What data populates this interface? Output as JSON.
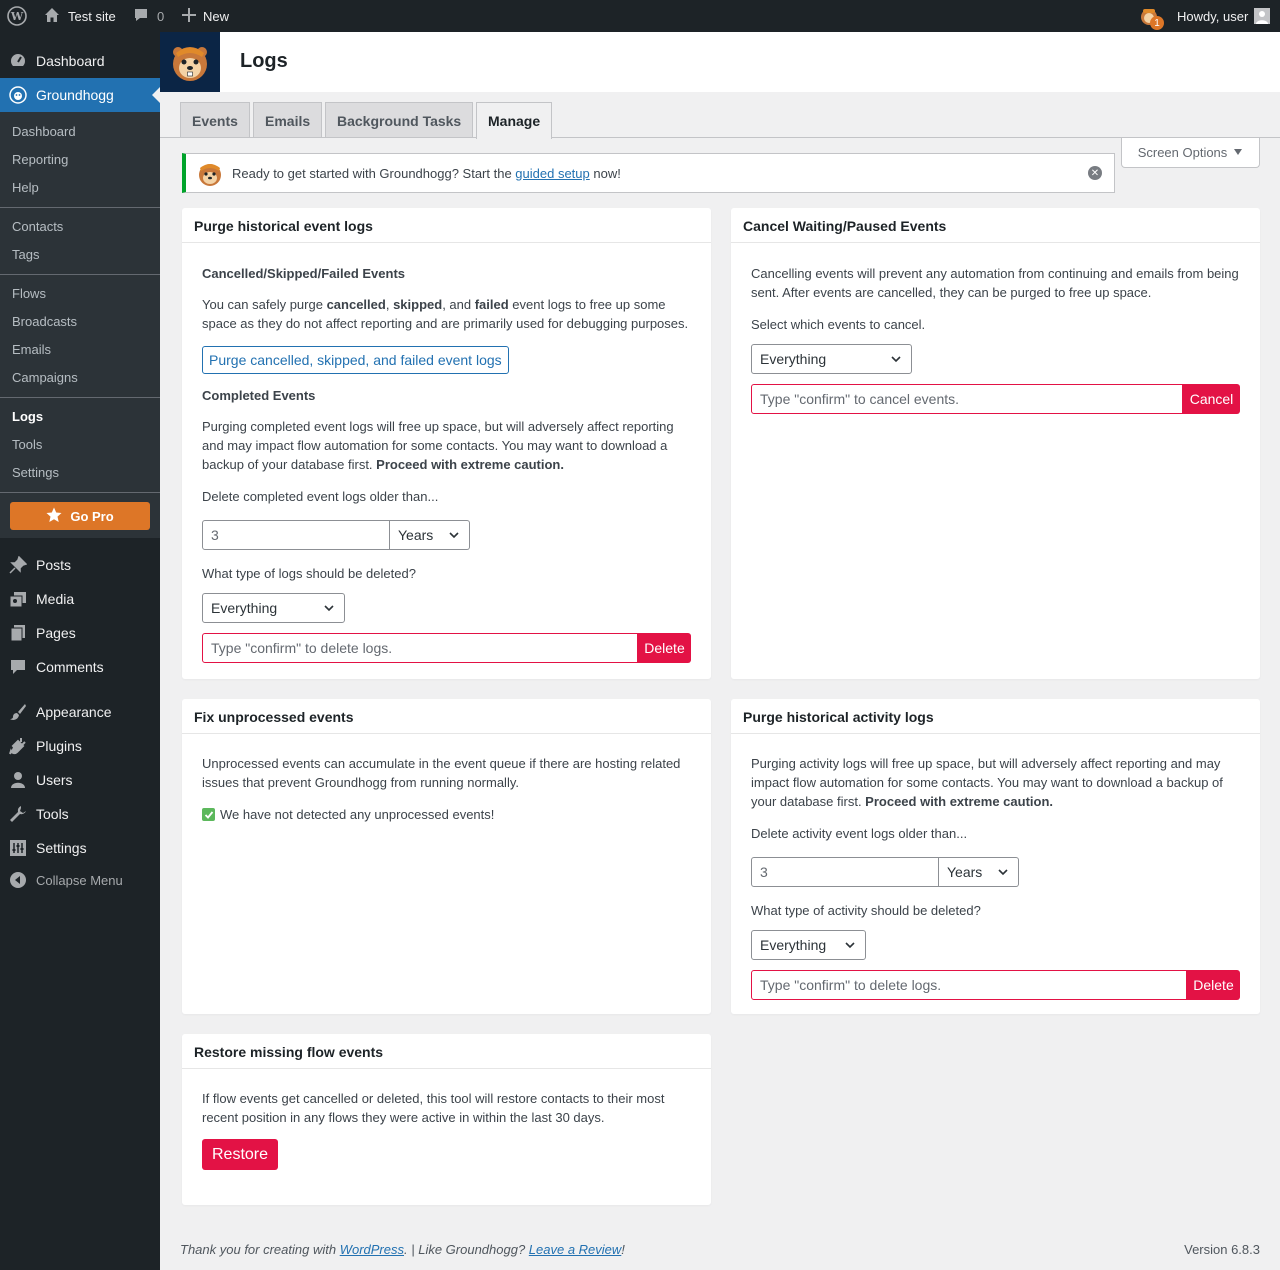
{
  "adminbar": {
    "site_name": "Test site",
    "comments_count": "0",
    "new_label": "New",
    "notification_count": "1",
    "howdy": "Howdy, user"
  },
  "sidebar": {
    "dashboard": "Dashboard",
    "groundhogg": "Groundhogg",
    "submenu": {
      "dashboard": "Dashboard",
      "reporting": "Reporting",
      "help": "Help",
      "contacts": "Contacts",
      "tags": "Tags",
      "flows": "Flows",
      "broadcasts": "Broadcasts",
      "emails": "Emails",
      "campaigns": "Campaigns",
      "logs": "Logs",
      "tools": "Tools",
      "settings": "Settings",
      "go_pro": "Go Pro"
    },
    "posts": "Posts",
    "media": "Media",
    "pages": "Pages",
    "comments": "Comments",
    "appearance": "Appearance",
    "plugins": "Plugins",
    "users": "Users",
    "tools": "Tools",
    "settings": "Settings",
    "collapse": "Collapse Menu"
  },
  "header": {
    "title": "Logs"
  },
  "tabs": {
    "events": "Events",
    "emails": "Emails",
    "background": "Background Tasks",
    "manage": "Manage"
  },
  "screen_options": "Screen Options",
  "notice": {
    "before": "Ready to get started with Groundhogg? Start the ",
    "link": "guided setup",
    "after": " now!"
  },
  "purge_event": {
    "title": "Purge historical event logs",
    "cancelled_heading": "Cancelled/Skipped/Failed Events",
    "p1_a": "You can safely purge ",
    "p1_b": "cancelled",
    "p1_c": ", ",
    "p1_d": "skipped",
    "p1_e": ", and ",
    "p1_f": "failed",
    "p1_g": " event logs to free up some space as they do not affect reporting and are primarily used for debugging purposes.",
    "purge_button": "Purge cancelled, skipped, and failed event logs",
    "completed_heading": "Completed Events",
    "p2_a": "Purging completed event logs will free up space, but will adversely affect reporting and may impact flow automation for some contacts. You may want to download a backup of your database first. ",
    "p2_b": "Proceed with extreme caution.",
    "older_label": "Delete completed event logs older than...",
    "age_value": "3",
    "age_unit": "Years",
    "type_label": "What type of logs should be deleted?",
    "type_value": "Everything",
    "confirm_placeholder": "Type \"confirm\" to delete logs.",
    "delete_button": "Delete"
  },
  "cancel_waiting": {
    "title": "Cancel Waiting/Paused Events",
    "p1": "Cancelling events will prevent any automation from continuing and emails from being sent. After events are cancelled, they can be purged to free up space.",
    "select_label": "Select which events to cancel.",
    "select_value": "Everything",
    "confirm_placeholder": "Type \"confirm\" to cancel events.",
    "cancel_button": "Cancel"
  },
  "fix_unprocessed": {
    "title": "Fix unprocessed events",
    "p1": "Unprocessed events can accumulate in the event queue if there are hosting related issues that prevent Groundhogg from running normally.",
    "status": "We have not detected any unprocessed events!"
  },
  "purge_activity": {
    "title": "Purge historical activity logs",
    "p1_a": "Purging activity logs will free up space, but will adversely affect reporting and may impact flow automation for some contacts. You may want to download a backup of your database first. ",
    "p1_b": "Proceed with extreme caution.",
    "older_label": "Delete activity event logs older than...",
    "age_value": "3",
    "age_unit": "Years",
    "type_label": "What type of activity should be deleted?",
    "type_value": "Everything",
    "confirm_placeholder": "Type \"confirm\" to delete logs.",
    "delete_button": "Delete"
  },
  "restore": {
    "title": "Restore missing flow events",
    "p1": "If flow events get cancelled or deleted, this tool will restore contacts to their most recent position in any flows they were active in within the last 30 days.",
    "button": "Restore"
  },
  "footer": {
    "a": "Thank you for creating with ",
    "wp_link": "WordPress",
    "b": ". | Like Groundhogg? ",
    "review_link": "Leave a Review",
    "c": "!",
    "version": "Version 6.8.3"
  },
  "colors": {
    "accent": "#2271b1",
    "danger": "#e31245",
    "success": "#00a32a",
    "gopro": "#dd7627"
  }
}
